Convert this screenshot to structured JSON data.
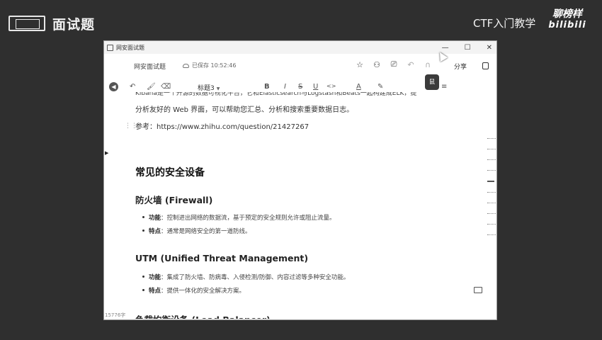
{
  "slide": {
    "title": "面试题",
    "course_label": "CTF入门教学",
    "brand_top": "聊榜样",
    "brand_bottom": "bilibili"
  },
  "window": {
    "title": "网安面试题",
    "controls": [
      "—",
      "☐",
      "✕"
    ]
  },
  "docbar": {
    "doc_name": "网安面试题",
    "save_status": "已保存 10:52:46",
    "share_label": "分享"
  },
  "toolbar": {
    "undo": "↶",
    "format_painter": "🖌",
    "clear": "⌫",
    "heading_select": "标题3",
    "bold": "B",
    "italic": "I",
    "strike": "S",
    "underline": "U",
    "code": "<>",
    "font_color": "A",
    "highlight": "✎",
    "align": "≡",
    "dark_button": "鼠"
  },
  "content": {
    "cut_line": "Kibana是一个开源的数据可视化平台，它和Elasticsearch与Logstash和Beats一起构建成ELK，提供友好的",
    "para1": "分析友好的 Web 界面，可以帮助您汇总、分析和搜索重要数据日志。",
    "para2": "参考：https://www.zhihu.com/question/21427267",
    "h2": "常见的安全设备",
    "sections": [
      {
        "heading": "防火墙 (Firewall)",
        "items": [
          {
            "key": "功能",
            "text": "：控制进出网络的数据流，基于预定的安全规则允许或阻止流量。"
          },
          {
            "key": "特点",
            "text": "：通常是网络安全的第一道防线。"
          }
        ]
      },
      {
        "heading": "UTM (Unified Threat Management)",
        "items": [
          {
            "key": "功能",
            "text": "：集成了防火墙、防病毒、入侵检测/防御、内容过滤等多种安全功能。"
          },
          {
            "key": "特点",
            "text": "：提供一体化的安全解决方案。"
          }
        ]
      },
      {
        "heading": "负载均衡设备 (Load Balancer)",
        "items": []
      }
    ]
  },
  "status": {
    "word_count": "15776字"
  }
}
